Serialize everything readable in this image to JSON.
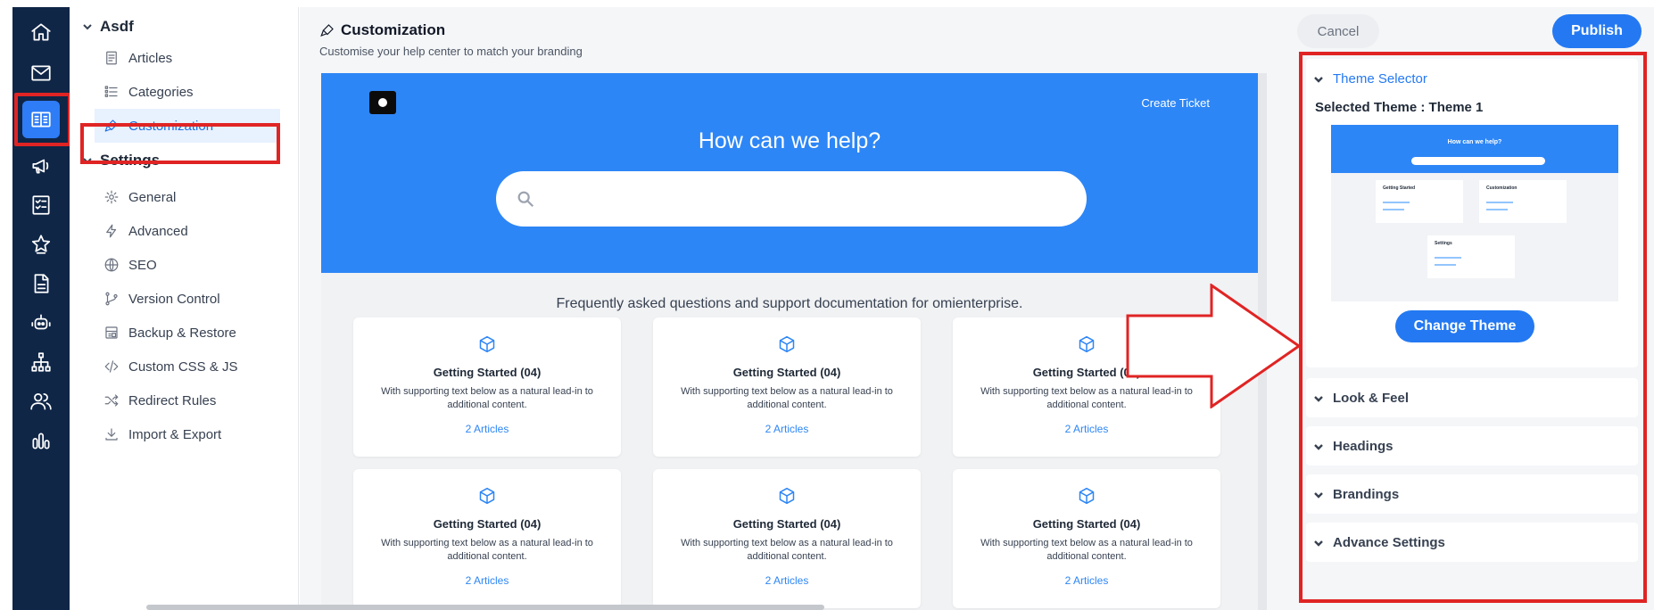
{
  "rail": {
    "items": [
      "home-icon",
      "mail-icon",
      "knowledge-base-icon",
      "megaphone-icon",
      "checklist-icon",
      "star-badge-icon",
      "document-icon",
      "robot-icon",
      "sitemap-icon",
      "users-icon",
      "bar-chart-icon"
    ],
    "active": "knowledge-base-icon"
  },
  "nav": {
    "workspace": "Asdf",
    "items": [
      {
        "label": "Articles",
        "icon": "articles-icon"
      },
      {
        "label": "Categories",
        "icon": "list-icon"
      },
      {
        "label": "Customization",
        "icon": "brush-icon"
      }
    ],
    "settings_label": "Settings",
    "settings_items": [
      {
        "label": "General",
        "icon": "gear-icon"
      },
      {
        "label": "Advanced",
        "icon": "bolt-icon"
      },
      {
        "label": "SEO",
        "icon": "globe-icon"
      },
      {
        "label": "Version Control",
        "icon": "branch-icon"
      },
      {
        "label": "Backup & Restore",
        "icon": "backup-icon"
      },
      {
        "label": "Custom CSS & JS",
        "icon": "code-icon"
      },
      {
        "label": "Redirect Rules",
        "icon": "shuffle-icon"
      },
      {
        "label": "Import & Export",
        "icon": "download-icon"
      }
    ]
  },
  "header": {
    "title": "Customization",
    "subtitle": "Customise your help center to match your branding",
    "cancel_label": "Cancel",
    "publish_label": "Publish"
  },
  "preview": {
    "create_ticket": "Create Ticket",
    "hero_title": "How can we help?",
    "faq_line": "Frequently asked questions and support documentation for omienterprise.",
    "cards": [
      {
        "title": "Getting Started (04)",
        "text": "With supporting text below as a natural lead-in to additional content.",
        "link": "2 Articles"
      },
      {
        "title": "Getting Started (04)",
        "text": "With supporting text below as a natural lead-in to additional content.",
        "link": "2 Articles"
      },
      {
        "title": "Getting Started (04)",
        "text": "With supporting text below as a natural lead-in to additional content.",
        "link": "2 Articles"
      },
      {
        "title": "Getting Started (04)",
        "text": "With supporting text below as a natural lead-in to additional content.",
        "link": "2 Articles"
      },
      {
        "title": "Getting Started (04)",
        "text": "With supporting text below as a natural lead-in to additional content.",
        "link": "2 Articles"
      },
      {
        "title": "Getting Started (04)",
        "text": "With supporting text below as a natural lead-in to additional content.",
        "link": "2 Articles"
      }
    ]
  },
  "panel": {
    "theme_selector": "Theme Selector",
    "selected_theme": "Selected Theme : Theme 1",
    "thumb_title": "How can we help?",
    "thumb_cards": [
      "Getting Started",
      "Customization",
      "Settings"
    ],
    "change_theme_label": "Change Theme",
    "sections": [
      "Look & Feel",
      "Headings",
      "Brandings",
      "Advance Settings"
    ]
  },
  "colors": {
    "rail_bg": "#0f2647",
    "accent": "#2479f2",
    "hero": "#2d86f6",
    "highlight": "#e02424"
  }
}
